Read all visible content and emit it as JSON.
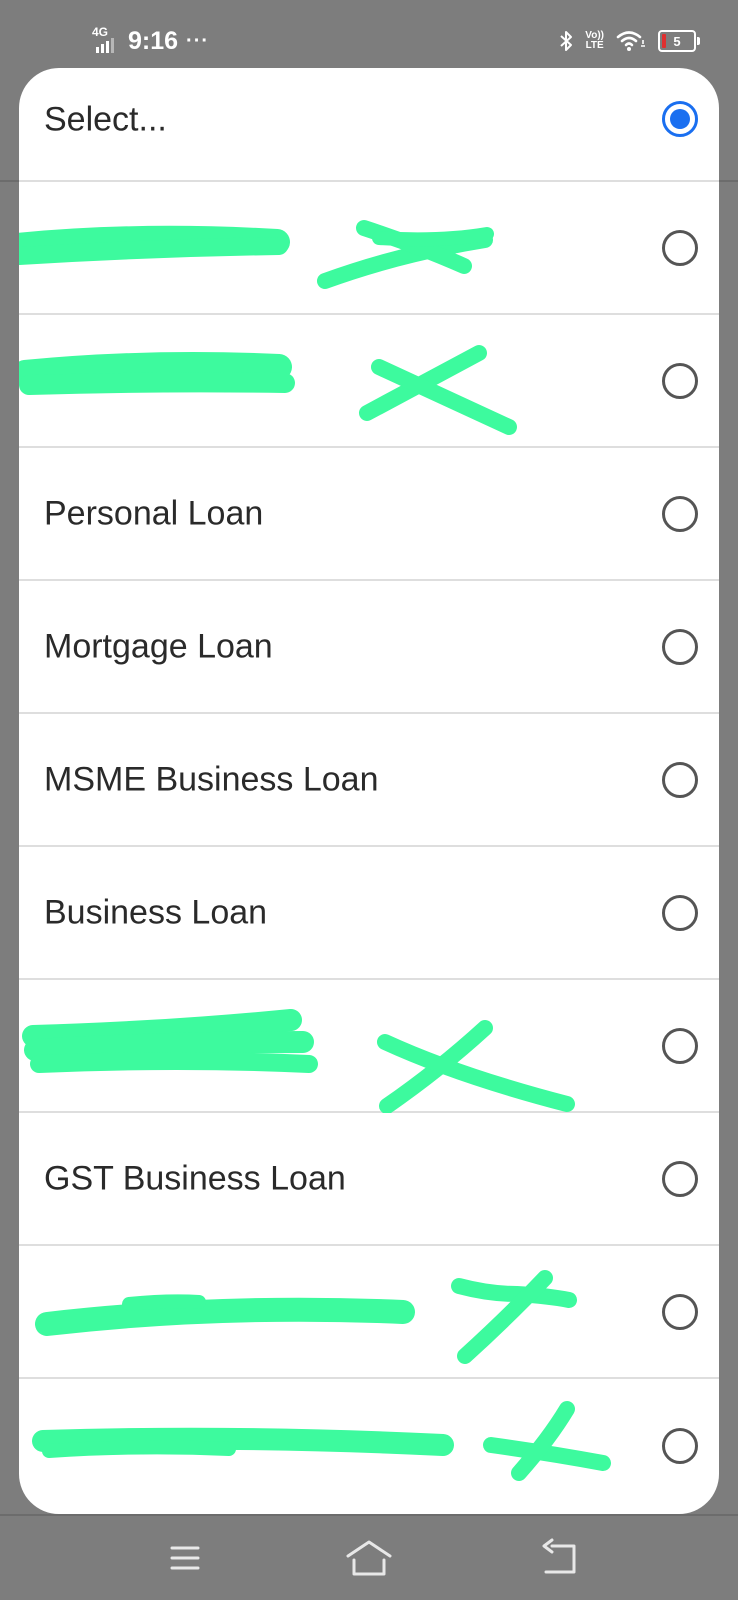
{
  "status_bar": {
    "network": "4G",
    "time": "9:16",
    "more": "···",
    "volte_top": "Vo))",
    "volte_bottom": "LTE",
    "battery": "5",
    "icons": [
      "signal-icon",
      "bluetooth-icon",
      "volte-icon",
      "wifi-icon",
      "battery-icon"
    ]
  },
  "dialog": {
    "selected_index": 0,
    "accent_color": "#1a6ff0",
    "redaction_color": "#3dfa9e",
    "options": [
      {
        "label": "Select...",
        "selected": true,
        "redacted": false
      },
      {
        "label": "",
        "selected": false,
        "redacted": true
      },
      {
        "label": "",
        "selected": false,
        "redacted": true
      },
      {
        "label": "Personal Loan",
        "selected": false,
        "redacted": false
      },
      {
        "label": "Mortgage Loan",
        "selected": false,
        "redacted": false
      },
      {
        "label": "MSME Business Loan",
        "selected": false,
        "redacted": false
      },
      {
        "label": "Business Loan",
        "selected": false,
        "redacted": false
      },
      {
        "label": "",
        "selected": false,
        "redacted": true
      },
      {
        "label": "GST Business Loan",
        "selected": false,
        "redacted": false
      },
      {
        "label": "",
        "selected": false,
        "redacted": true
      },
      {
        "label": "",
        "selected": false,
        "redacted": true
      }
    ]
  },
  "nav_bar": {
    "buttons": [
      "menu-icon",
      "home-icon",
      "back-icon"
    ]
  }
}
